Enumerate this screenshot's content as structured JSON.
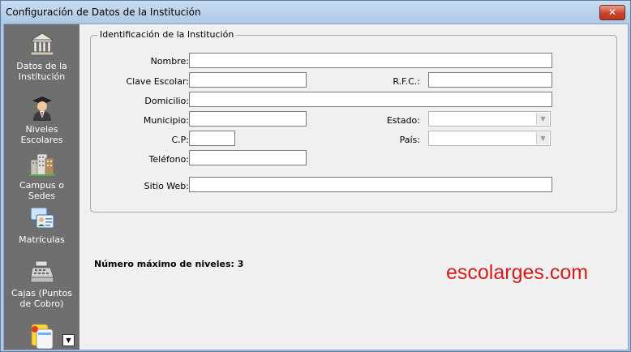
{
  "window": {
    "title": "Configuración de Datos de la Institución",
    "close_glyph": "✕"
  },
  "sidebar": {
    "items": [
      {
        "label": "Datos de la Institución",
        "icon": "institution-building-icon"
      },
      {
        "label": "Niveles Escolares",
        "icon": "graduate-icon"
      },
      {
        "label": "Campus o Sedes",
        "icon": "campus-buildings-icon"
      },
      {
        "label": "Matrículas",
        "icon": "id-cards-icon"
      },
      {
        "label": "Cajas (Puntos de Cobro)",
        "icon": "cash-register-icon"
      },
      {
        "label": "",
        "icon": "cards-icon"
      }
    ],
    "more_glyph": "▼"
  },
  "group": {
    "legend": "Identificación de la Institución",
    "fields": {
      "nombre": {
        "label": "Nombre:",
        "value": ""
      },
      "clave_escolar": {
        "label": "Clave Escolar:",
        "value": ""
      },
      "rfc": {
        "label": "R.F.C.:",
        "value": ""
      },
      "domicilio": {
        "label": "Domicilio:",
        "value": ""
      },
      "municipio": {
        "label": "Municipio:",
        "value": ""
      },
      "estado": {
        "label": "Estado:",
        "value": ""
      },
      "cp": {
        "label": "C.P:",
        "value": ""
      },
      "pais": {
        "label": "País:",
        "value": ""
      },
      "telefono": {
        "label": "Teléfono:",
        "value": ""
      },
      "sitio_web": {
        "label": "Sitio Web:",
        "value": ""
      }
    }
  },
  "footer": {
    "max_levels": "Número máximo de niveles: 3"
  },
  "watermark": "escolarges.com",
  "colors": {
    "sidebar_bg": "#6f6f6f",
    "watermark": "#d81b1b"
  }
}
